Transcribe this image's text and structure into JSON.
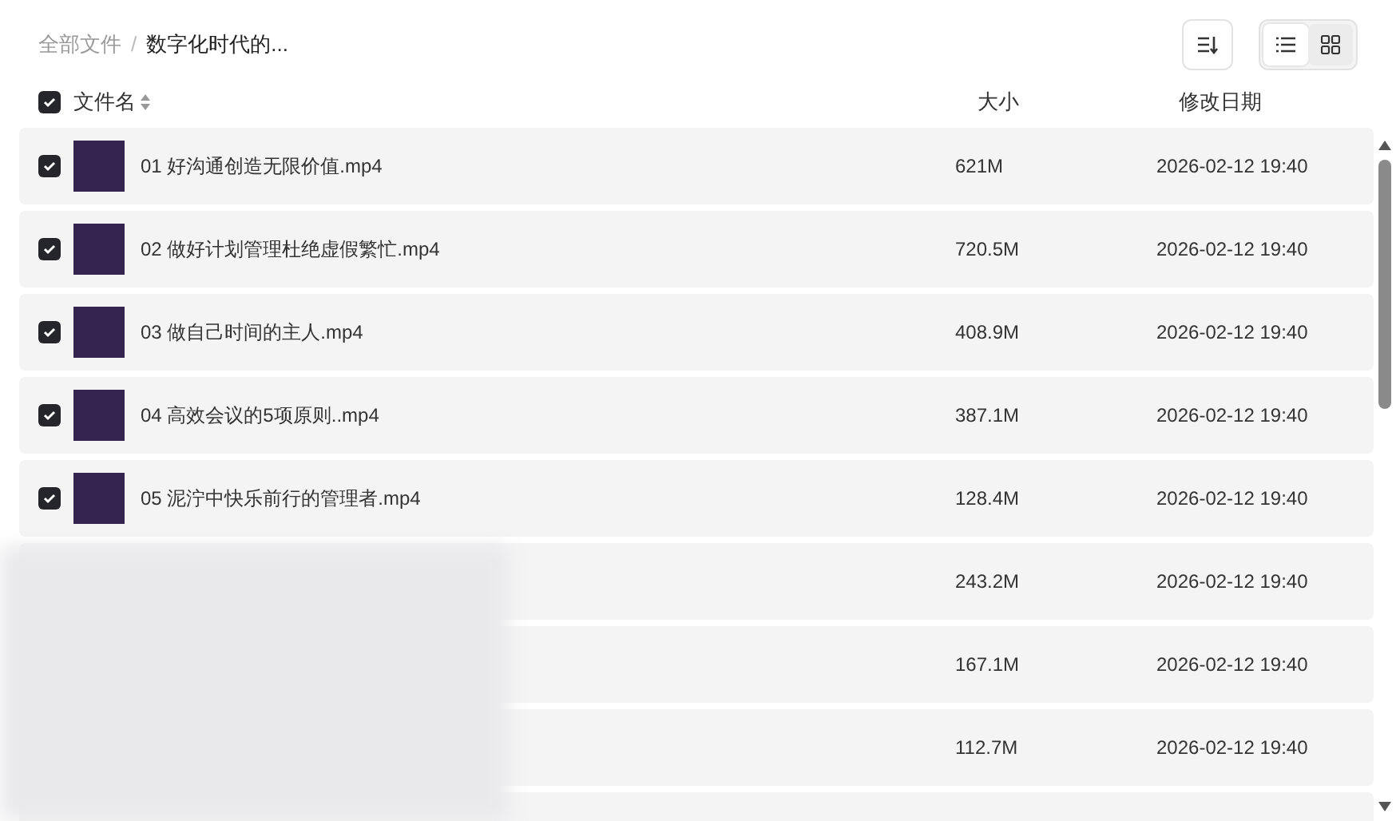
{
  "breadcrumb": [
    {
      "label": "全部文件",
      "current": false
    },
    {
      "separator": "/",
      "label": "数字化时代的...",
      "current": true
    }
  ],
  "view_modes": [
    {
      "kind": "list",
      "selected": true
    },
    {
      "kind": "grid",
      "selected": false
    }
  ],
  "table": {
    "all_checked": true,
    "columns": [
      "文件名",
      "大小",
      "修改日期"
    ],
    "rows": [
      {
        "name": "01 好沟通创造无限价值.mp4",
        "size": "621M",
        "date": "2026-02-12 19:40",
        "checked": true
      },
      {
        "name": "02 做好计划管理杜绝虚假繁忙.mp4",
        "size": "720.5M",
        "date": "2026-02-12 19:40",
        "checked": true
      },
      {
        "name": "03 做自己时间的主人.mp4",
        "size": "408.9M",
        "date": "2026-02-12 19:40",
        "checked": true
      },
      {
        "name": "04 高效会议的5项原则..mp4",
        "size": "387.1M",
        "date": "2026-02-12 19:40",
        "checked": true
      },
      {
        "name": "05 泥泞中快乐前行的管理者.mp4",
        "size": "128.4M",
        "date": "2026-02-12 19:40",
        "checked": true
      },
      {
        "size": "243.2M",
        "date": "2026-02-12 19:40"
      },
      {
        "size": "167.1M",
        "date": "2026-02-12 19:40"
      },
      {
        "size": "112.7M",
        "date": "2026-02-12 19:40"
      },
      {}
    ]
  }
}
